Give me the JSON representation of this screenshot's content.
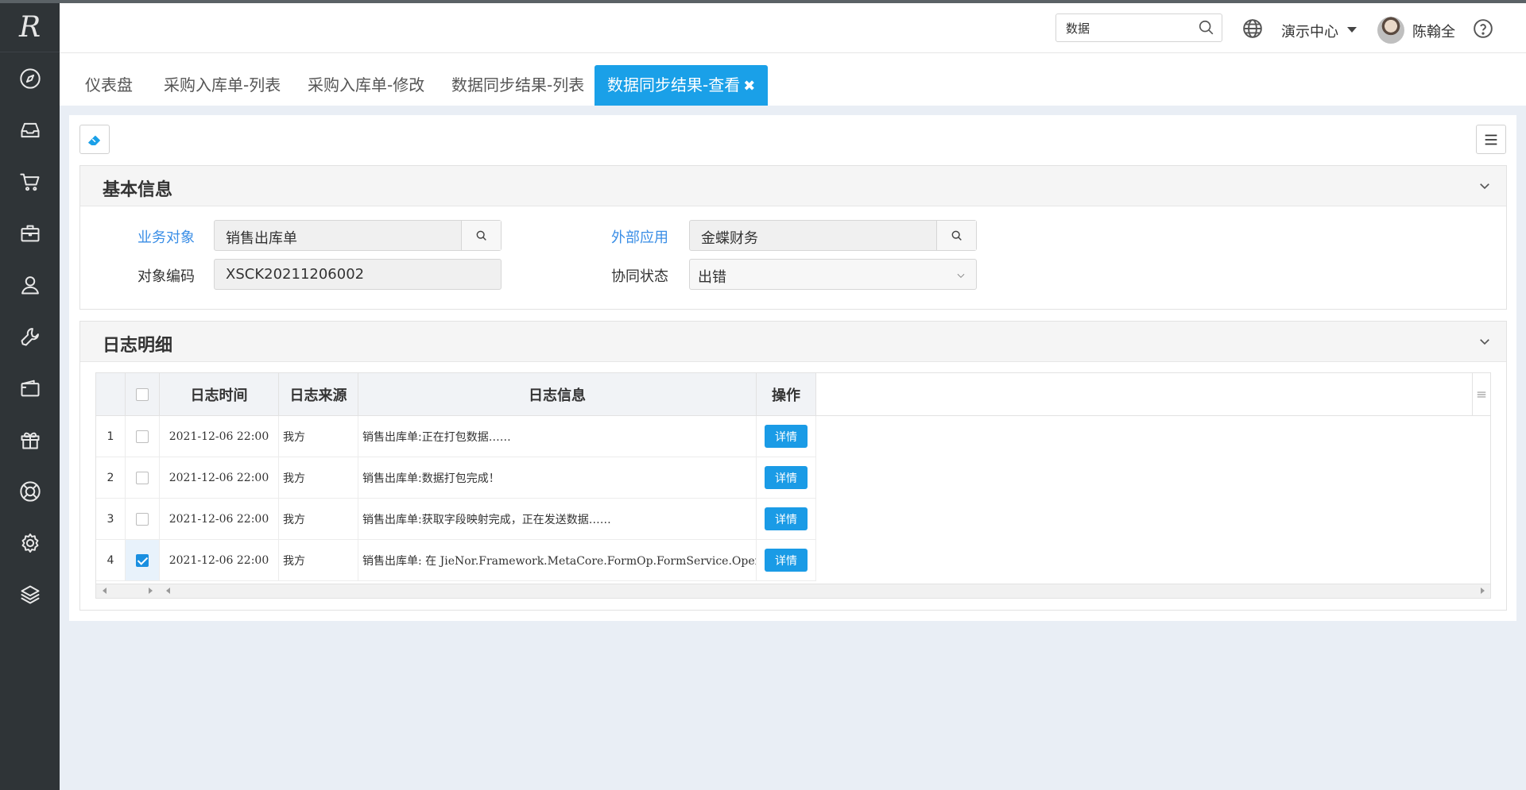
{
  "sidebar": {
    "logo": "R",
    "items": [
      "compass-icon",
      "inbox-icon",
      "cart-icon",
      "briefcase-icon",
      "user-icon",
      "wrench-icon",
      "wallet-icon",
      "gift-icon",
      "lifebuoy-icon",
      "gear-icon",
      "layers-icon"
    ]
  },
  "header": {
    "search_value": "数据",
    "center_label": "演示中心",
    "user_name": "陈翰全"
  },
  "tabs": [
    {
      "label": "仪表盘",
      "active": false
    },
    {
      "label": "采购入库单-列表",
      "active": false
    },
    {
      "label": "采购入库单-修改",
      "active": false
    },
    {
      "label": "数据同步结果-列表",
      "active": false
    },
    {
      "label": "数据同步结果-查看",
      "active": true,
      "close": "✖"
    }
  ],
  "basic_info": {
    "title": "基本信息",
    "business_object_label": "业务对象",
    "business_object_value": "销售出库单",
    "external_app_label": "外部应用",
    "external_app_value": "金蝶财务",
    "object_code_label": "对象编码",
    "object_code_value": "XSCK20211206002",
    "sync_status_label": "协同状态",
    "sync_status_value": "出错"
  },
  "log_detail": {
    "title": "日志明细",
    "columns": {
      "time": "日志时间",
      "source": "日志来源",
      "info": "日志信息",
      "action": "操作"
    },
    "rows": [
      {
        "no": "1",
        "checked": false,
        "time": "2021-12-06 22:00",
        "source": "我方",
        "info": "销售出库单:正在打包数据……",
        "action": "详情"
      },
      {
        "no": "2",
        "checked": false,
        "time": "2021-12-06 22:00",
        "source": "我方",
        "info": "销售出库单:数据打包完成！",
        "action": "详情"
      },
      {
        "no": "3",
        "checked": false,
        "time": "2021-12-06 22:00",
        "source": "我方",
        "info": "销售出库单:获取字段映射完成，正在发送数据……",
        "action": "详情"
      },
      {
        "no": "4",
        "checked": true,
        "time": "2021-12-06 22:00",
        "source": "我方",
        "info": "销售出库单: 在 JieNor.Framework.MetaCore.FormOp.FormService.Operatio…",
        "action": "详情"
      }
    ]
  },
  "colors": {
    "accent": "#1aa0e8",
    "sidebar": "#2f3437",
    "label_blue": "#3a8ee6"
  }
}
